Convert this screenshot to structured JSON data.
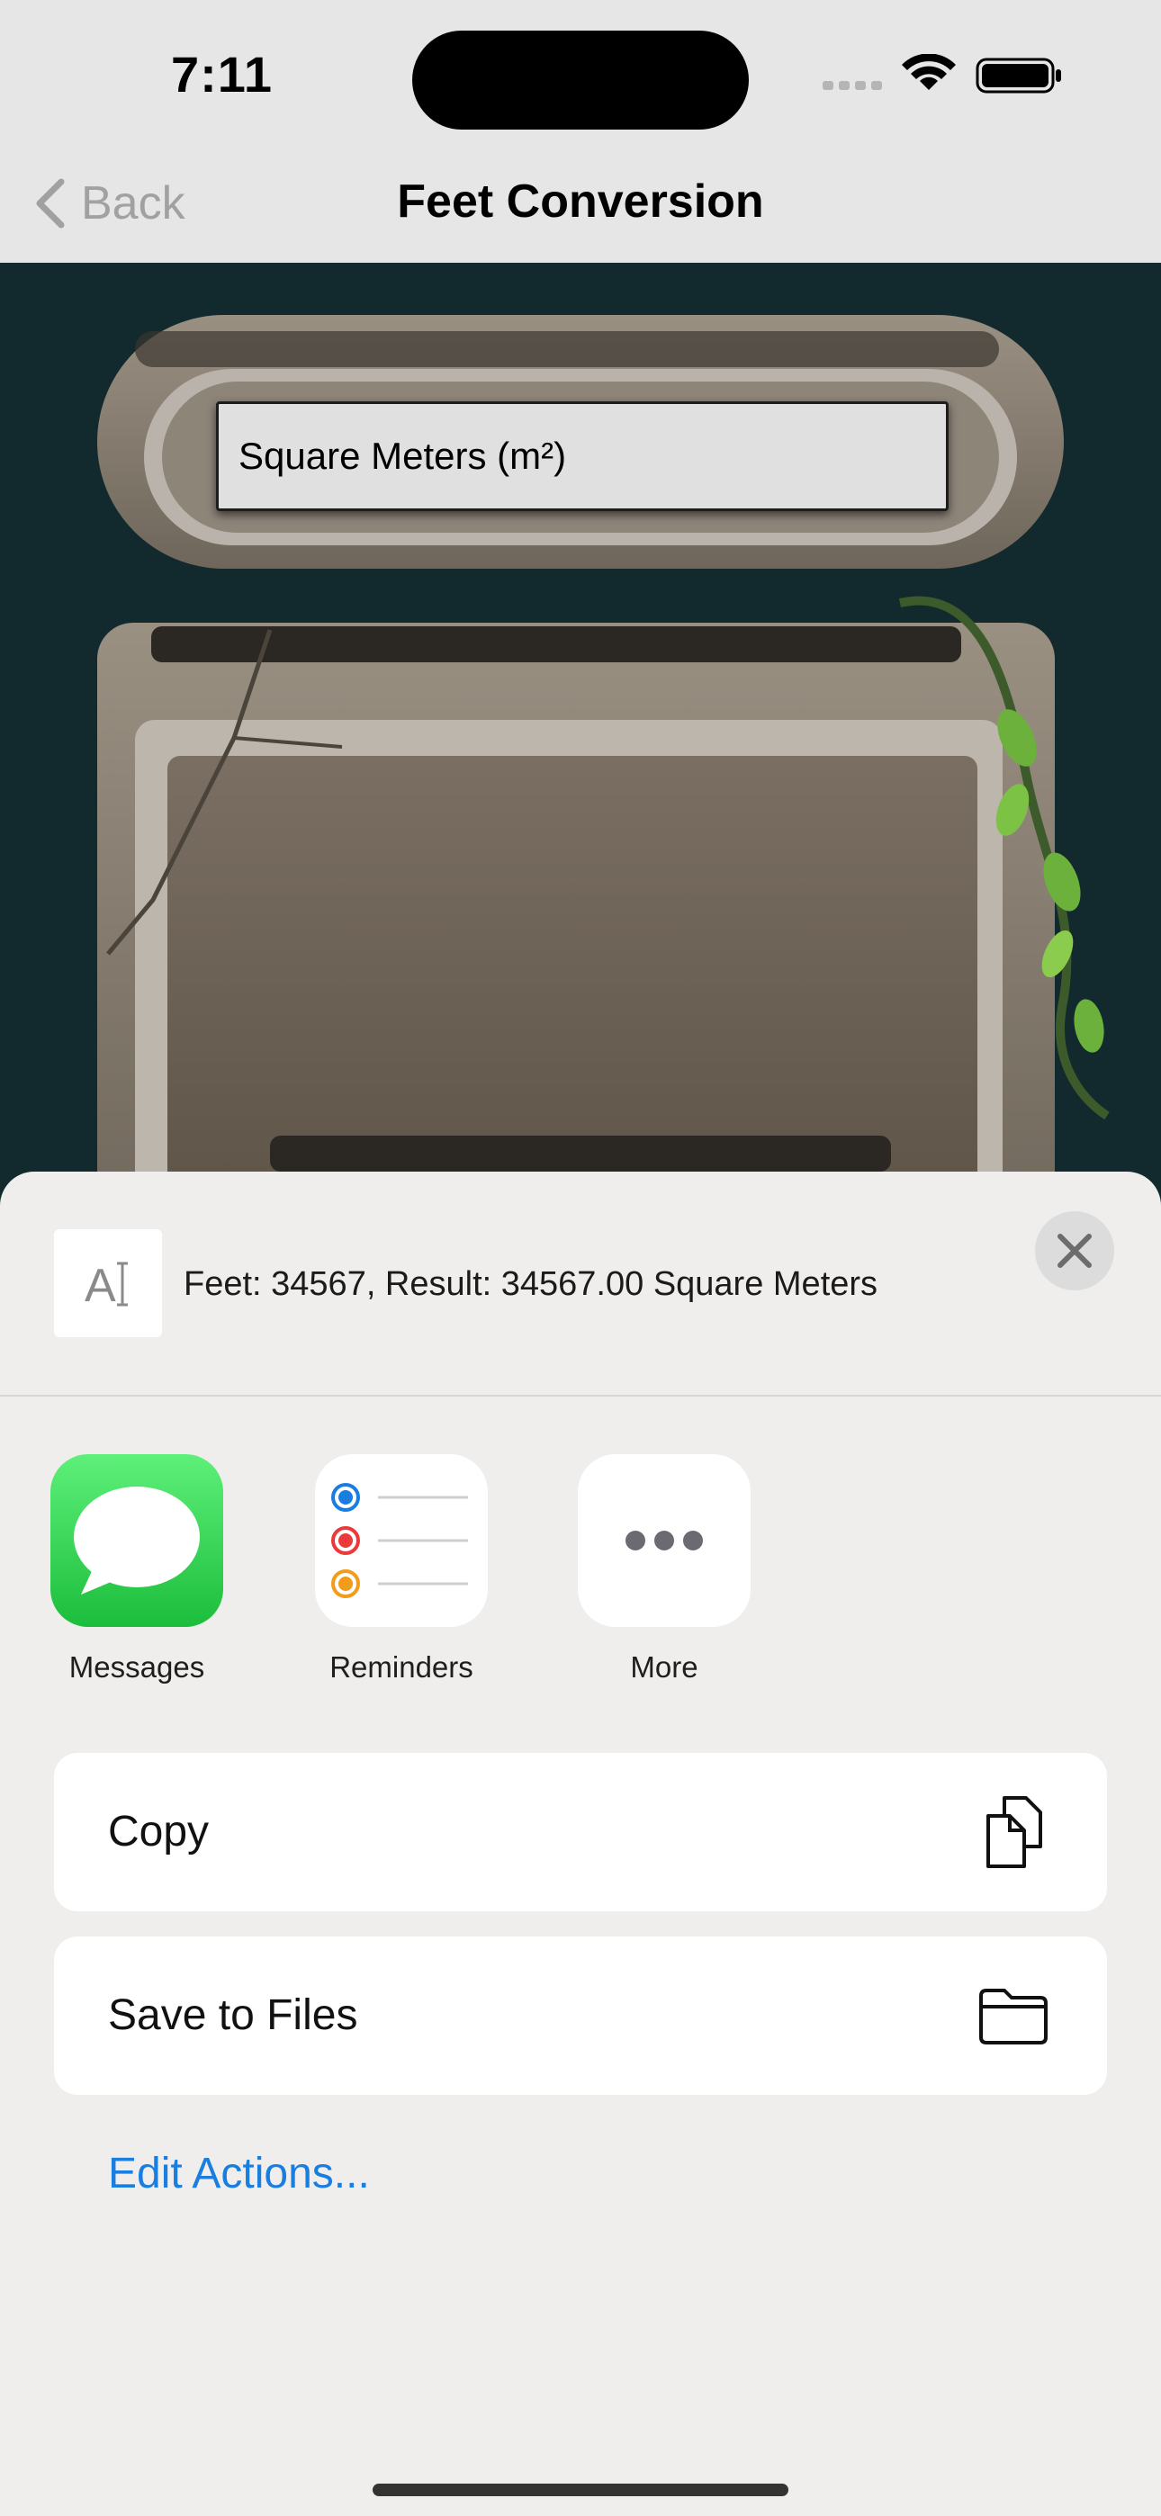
{
  "status_bar": {
    "time": "7:11"
  },
  "nav": {
    "back_label": "Back",
    "title": "Feet Conversion"
  },
  "game": {
    "unit_field": "Square Meters (m²)"
  },
  "share_sheet": {
    "preview_text": "Feet: 34567, Result: 34567.00 Square Meters",
    "preview_icon": "text-document-icon",
    "apps": [
      {
        "label": "Messages",
        "icon": "messages-icon"
      },
      {
        "label": "Reminders",
        "icon": "reminders-icon"
      },
      {
        "label": "More",
        "icon": "more-icon"
      }
    ],
    "actions": [
      {
        "label": "Copy",
        "icon": "copy-icon"
      },
      {
        "label": "Save to Files",
        "icon": "folder-icon"
      }
    ],
    "edit_actions": "Edit Actions...",
    "colors": {
      "accent": "#1a7de0",
      "messages_green": "#34c759"
    }
  }
}
